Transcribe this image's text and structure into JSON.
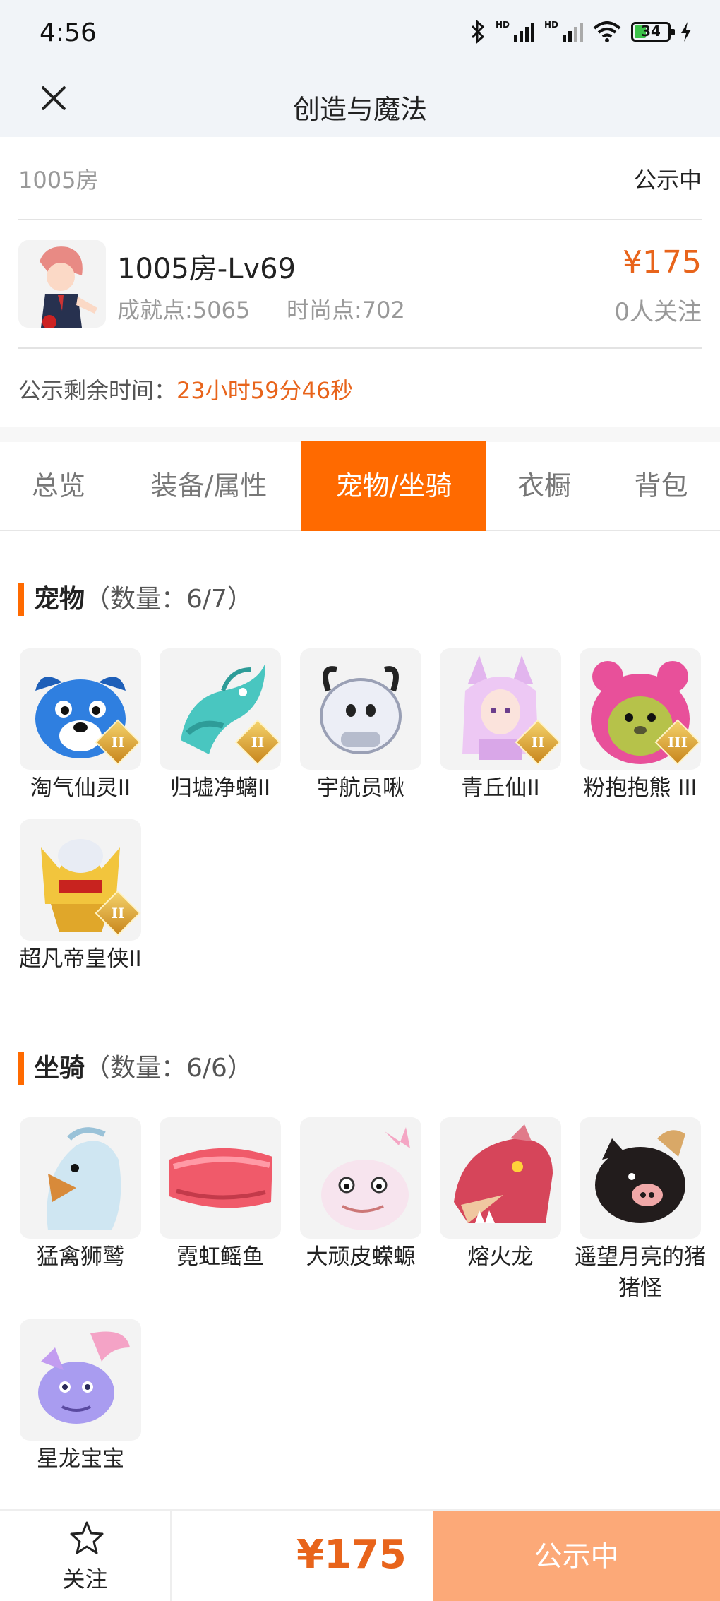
{
  "status_bar": {
    "time": "4:56",
    "battery": "34"
  },
  "header": {
    "title": "创造与魔法"
  },
  "room": {
    "name": "1005房",
    "status": "公示中"
  },
  "character": {
    "name": "1005房-Lv69",
    "achievement": "成就点:5065",
    "fashion": "时尚点:702",
    "price": "¥175",
    "followers": "0人关注"
  },
  "remaining": {
    "label": "公示剩余时间：",
    "value": "23小时59分46秒"
  },
  "tabs": [
    {
      "label": "总览",
      "active": false
    },
    {
      "label": "装备/属性",
      "active": false
    },
    {
      "label": "宠物/坐骑",
      "active": true
    },
    {
      "label": "衣橱",
      "active": false
    },
    {
      "label": "背包",
      "active": false
    }
  ],
  "pets": {
    "title": "宠物",
    "count": "（数量：6/7）",
    "items": [
      {
        "name": "淘气仙灵II",
        "rank": "II",
        "icon": "blue-dog-pet"
      },
      {
        "name": "归墟净螭II",
        "rank": "II",
        "icon": "teal-dragon-pet"
      },
      {
        "name": "宇航员啾",
        "rank": "",
        "icon": "astronaut-pet"
      },
      {
        "name": "青丘仙II",
        "rank": "II",
        "icon": "fox-fairy-pet"
      },
      {
        "name": "粉抱抱熊 III",
        "rank": "III",
        "icon": "pink-bear-pet"
      },
      {
        "name": "超凡帝皇侠II",
        "rank": "II",
        "icon": "golden-hero-pet"
      }
    ]
  },
  "mounts": {
    "title": "坐骑",
    "count": "（数量：6/6）",
    "items": [
      {
        "name": "猛禽狮鹫",
        "icon": "griffin-mount"
      },
      {
        "name": "霓虹鳐鱼",
        "icon": "ray-fish-mount"
      },
      {
        "name": "大顽皮蝾螈",
        "icon": "salamander-mount"
      },
      {
        "name": "熔火龙",
        "icon": "fire-dragon-mount"
      },
      {
        "name": "遥望月亮的猪猪怪",
        "icon": "pig-mount"
      },
      {
        "name": "星龙宝宝",
        "icon": "star-dragon-mount"
      }
    ]
  },
  "bottom_bar": {
    "follow_label": "关注",
    "price": "¥175",
    "action_label": "公示中"
  },
  "colors": {
    "accent": "#ff6a00",
    "price": "#e8641b",
    "action_bg": "#fca978"
  }
}
